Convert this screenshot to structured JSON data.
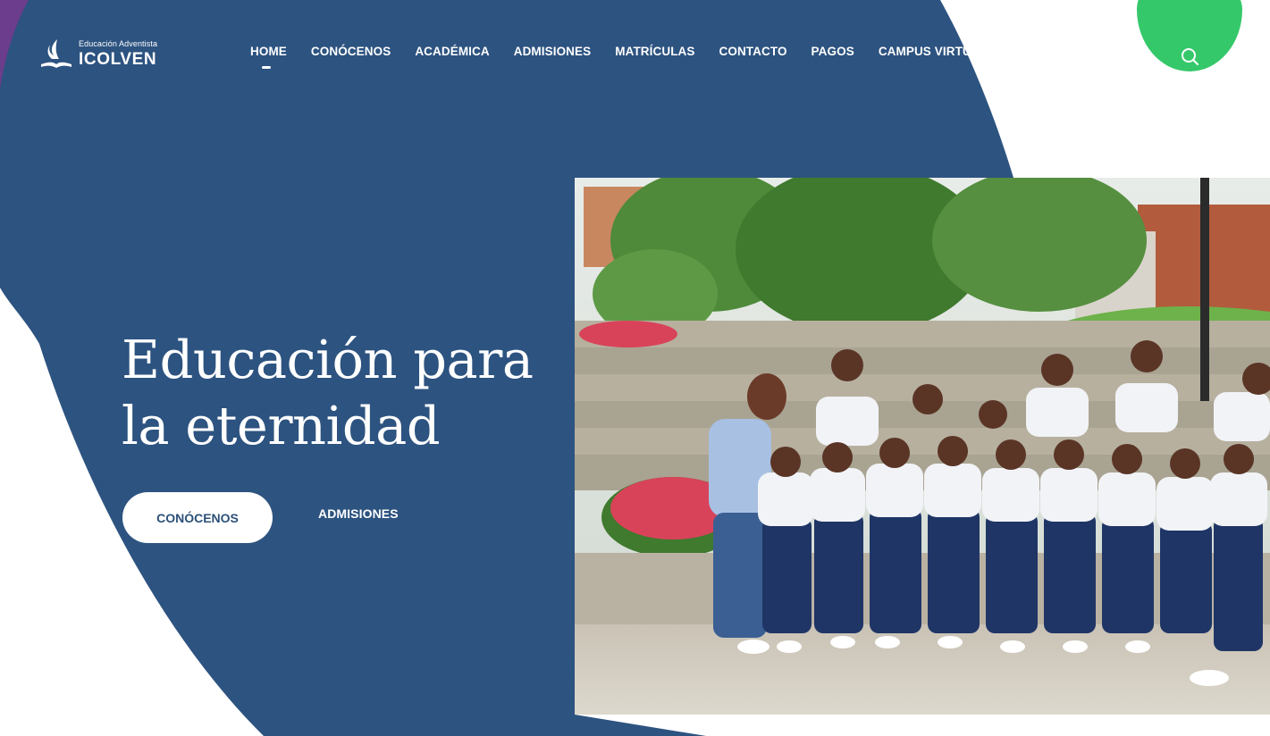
{
  "brand": {
    "subtitle": "Educación Adventista",
    "name": "ICOLVEN"
  },
  "nav": {
    "items": [
      {
        "label": "HOME",
        "active": true
      },
      {
        "label": "CONÓCENOS"
      },
      {
        "label": "ACADÉMICA"
      },
      {
        "label": "ADMISIONES"
      },
      {
        "label": "MATRÍCULAS"
      },
      {
        "label": "CONTACTO"
      },
      {
        "label": "PAGOS"
      },
      {
        "label": "CAMPUS VIRTUAL SINTIA"
      }
    ]
  },
  "header_icons": [
    "account-icon",
    "search-icon"
  ],
  "hero": {
    "title_line1": "Educación para",
    "title_line2": "la eternidad",
    "primary_button": "CONÓCENOS",
    "secondary_button": "ADMISIONES"
  },
  "colors": {
    "primary_blue": "#2d5380",
    "accent_green": "#35c86a",
    "accent_purple": "#6b3d8c",
    "background": "#ffffff"
  }
}
